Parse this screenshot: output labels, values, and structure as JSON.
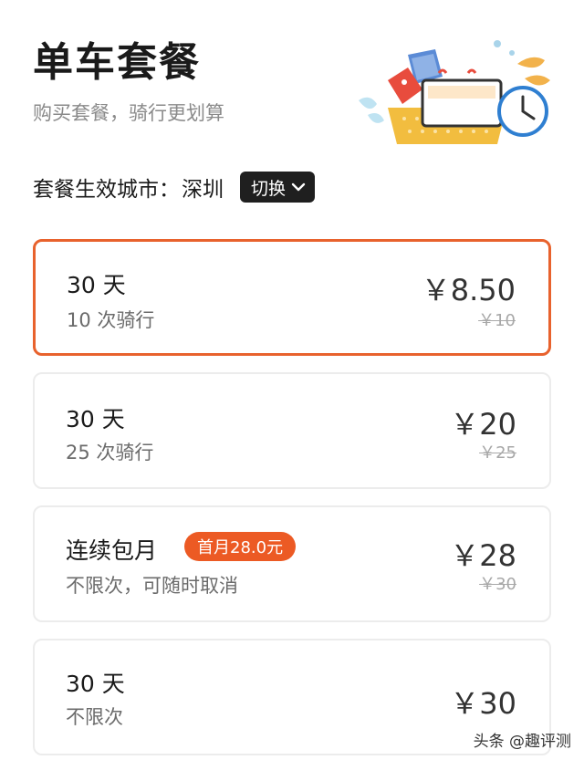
{
  "header": {
    "title": "单车套餐",
    "subtitle": "购买套餐，骑行更划算"
  },
  "city": {
    "label": "套餐生效城市：",
    "name": "深圳",
    "switch_label": "切换"
  },
  "plans": [
    {
      "days": "30 天",
      "rides": "10 次骑行",
      "price": "￥8.50",
      "original_price": "￥10",
      "selected": true
    },
    {
      "days": "30 天",
      "rides": "25 次骑行",
      "price": "￥20",
      "original_price": "￥25",
      "selected": false
    },
    {
      "days": "连续包月",
      "badge": "首月28.0元",
      "rides": "不限次，可随时取消",
      "price": "￥28",
      "original_price": "￥30",
      "selected": false
    },
    {
      "days": "30 天",
      "rides": "不限次",
      "price": "￥30",
      "selected": false
    }
  ],
  "watermark": "头条 @趣评测",
  "colors": {
    "accent": "#e8622d",
    "badge": "#ec5a24",
    "switch_bg": "#1f1f1f"
  }
}
